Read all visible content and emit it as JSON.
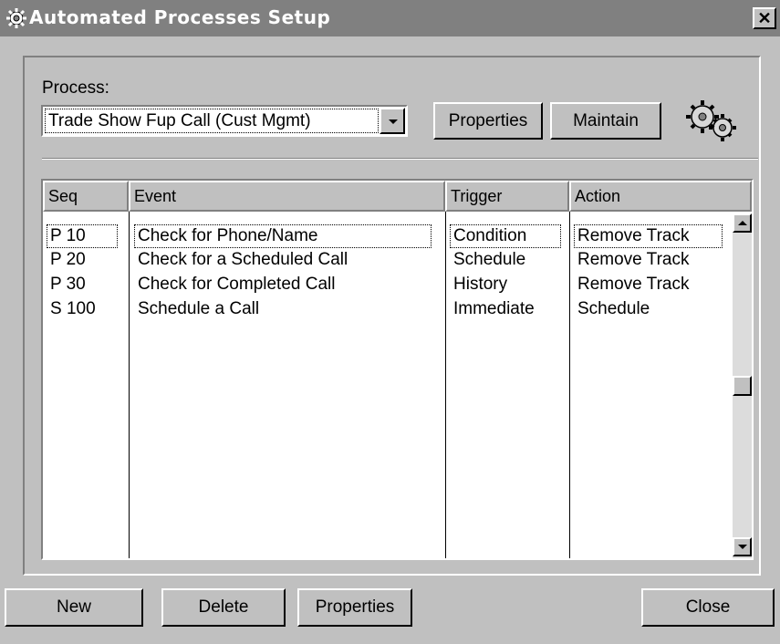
{
  "window": {
    "title": "Automated Processes Setup",
    "close_glyph": "✕"
  },
  "process": {
    "label": "Process:",
    "selected": "Trade Show Fup Call (Cust Mgmt)",
    "properties_button": "Properties",
    "maintain_button": "Maintain"
  },
  "table": {
    "columns": [
      "Seq",
      "Event",
      "Trigger",
      "Action"
    ],
    "rows": [
      {
        "seq": "P  10",
        "event": "Check for Phone/Name",
        "trigger": "Condition",
        "action": "Remove Track"
      },
      {
        "seq": "P  20",
        "event": "Check for a Scheduled Call",
        "trigger": "Schedule",
        "action": "Remove Track"
      },
      {
        "seq": "P  30",
        "event": "Check for Completed Call",
        "trigger": "History",
        "action": "Remove Track"
      },
      {
        "seq": "S  100",
        "event": "Schedule a Call",
        "trigger": "Immediate",
        "action": "Schedule"
      }
    ]
  },
  "buttons": {
    "new": "New",
    "delete": "Delete",
    "properties": "Properties",
    "close": "Close"
  },
  "icons": {
    "window_icon": "gear-icon",
    "process_icon": "gears-icon"
  },
  "colors": {
    "face": "#c0c0c0",
    "titlebar": "#808080",
    "window_bg": "#ffffff"
  }
}
